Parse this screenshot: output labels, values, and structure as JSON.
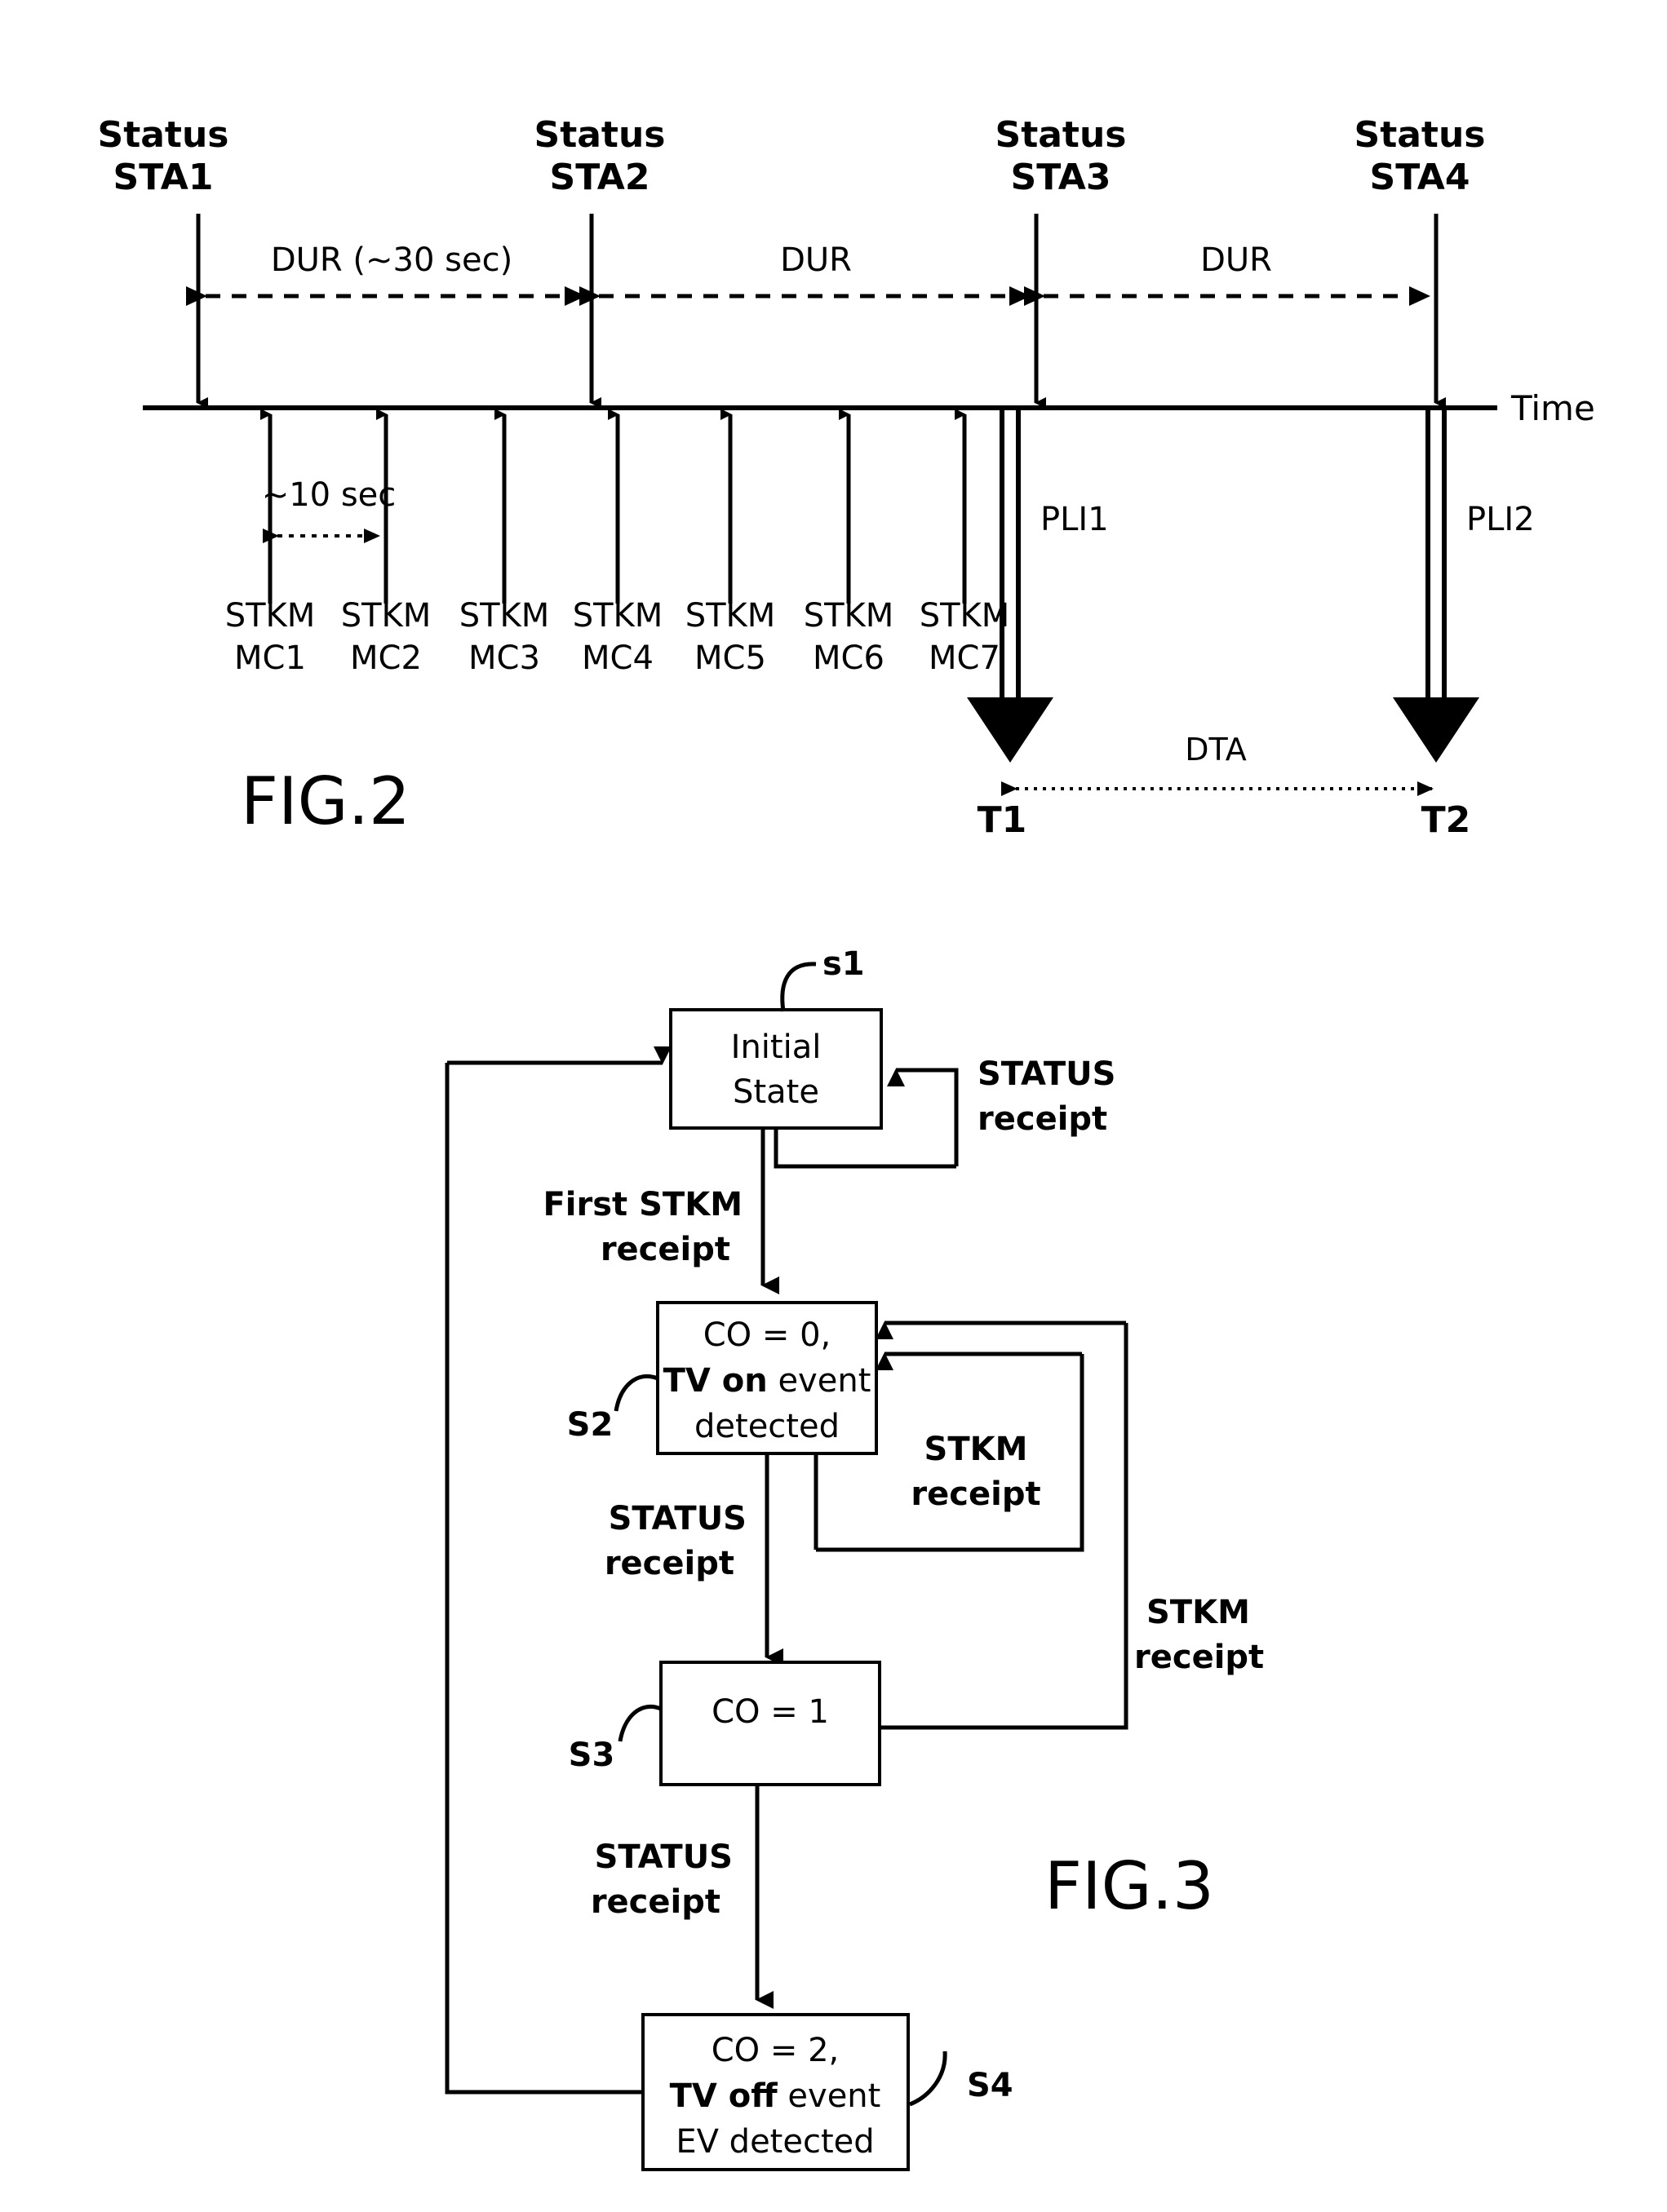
{
  "figure2": {
    "caption": "FIG.2",
    "axis_label": "Time",
    "status_events": [
      {
        "line1": "Status",
        "line2": "STA1"
      },
      {
        "line1": "Status",
        "line2": "STA2"
      },
      {
        "line1": "Status",
        "line2": "STA3"
      },
      {
        "line1": "Status",
        "line2": "STA4"
      }
    ],
    "duration_labels": [
      "DUR (~30 sec)",
      "DUR",
      "DUR"
    ],
    "interval_label": "~10 sec",
    "stkm_events": [
      {
        "line1": "STKM",
        "line2": "MC1"
      },
      {
        "line1": "STKM",
        "line2": "MC2"
      },
      {
        "line1": "STKM",
        "line2": "MC3"
      },
      {
        "line1": "STKM",
        "line2": "MC4"
      },
      {
        "line1": "STKM",
        "line2": "MC5"
      },
      {
        "line1": "STKM",
        "line2": "MC6"
      },
      {
        "line1": "STKM",
        "line2": "MC7"
      }
    ],
    "pli_labels": [
      "PLI1",
      "PLI2"
    ],
    "time_marks": [
      "T1",
      "T2"
    ],
    "dta_label": "DTA"
  },
  "figure3": {
    "caption": "FIG.3",
    "states": [
      {
        "ref": "s1",
        "lines": [
          {
            "text": "Initial",
            "bold": false
          },
          {
            "text": "State",
            "bold": false
          }
        ]
      },
      {
        "ref": "S2",
        "lines": [
          {
            "text": "CO = 0,",
            "bold": false
          },
          {
            "text": "TV on",
            "bold": true,
            "rest": " event"
          },
          {
            "text": "detected",
            "bold": false
          }
        ]
      },
      {
        "ref": "S3",
        "lines": [
          {
            "text": "CO = 1",
            "bold": false
          }
        ]
      },
      {
        "ref": "S4",
        "lines": [
          {
            "text": "CO = 2,",
            "bold": false
          },
          {
            "text": "TV off",
            "bold": true,
            "rest": " event"
          },
          {
            "text": "EV detected",
            "bold": false
          }
        ]
      }
    ],
    "state_box_text": {
      "s1_line1": "Initial",
      "s1_line2": "State",
      "s2_line1": "CO = 0,",
      "s2_line2_bold": "TV on",
      "s2_line2_rest": " event",
      "s2_line3": "detected",
      "s3_line1": "CO = 1",
      "s4_line1": "CO = 2,",
      "s4_line2_bold": "TV off",
      "s4_line2_rest": " event",
      "s4_line3": "EV detected"
    },
    "state_refs": {
      "s1": "s1",
      "s2": "S2",
      "s3": "S3",
      "s4": "S4"
    },
    "transitions": [
      {
        "id": "status_receipt_self",
        "line1": "STATUS",
        "line2": "receipt"
      },
      {
        "id": "first_stkm_receipt",
        "line1": "First STKM",
        "line2": "receipt"
      },
      {
        "id": "status_receipt_s2_s3",
        "line1": "STATUS",
        "line2": "receipt"
      },
      {
        "id": "stkm_receipt_s2_self",
        "line1": "STKM",
        "line2": "receipt"
      },
      {
        "id": "stkm_receipt_s3_s2",
        "line1": "STKM",
        "line2": "receipt"
      },
      {
        "id": "status_receipt_s3_s4",
        "line1": "STATUS",
        "line2": "receipt"
      }
    ]
  }
}
